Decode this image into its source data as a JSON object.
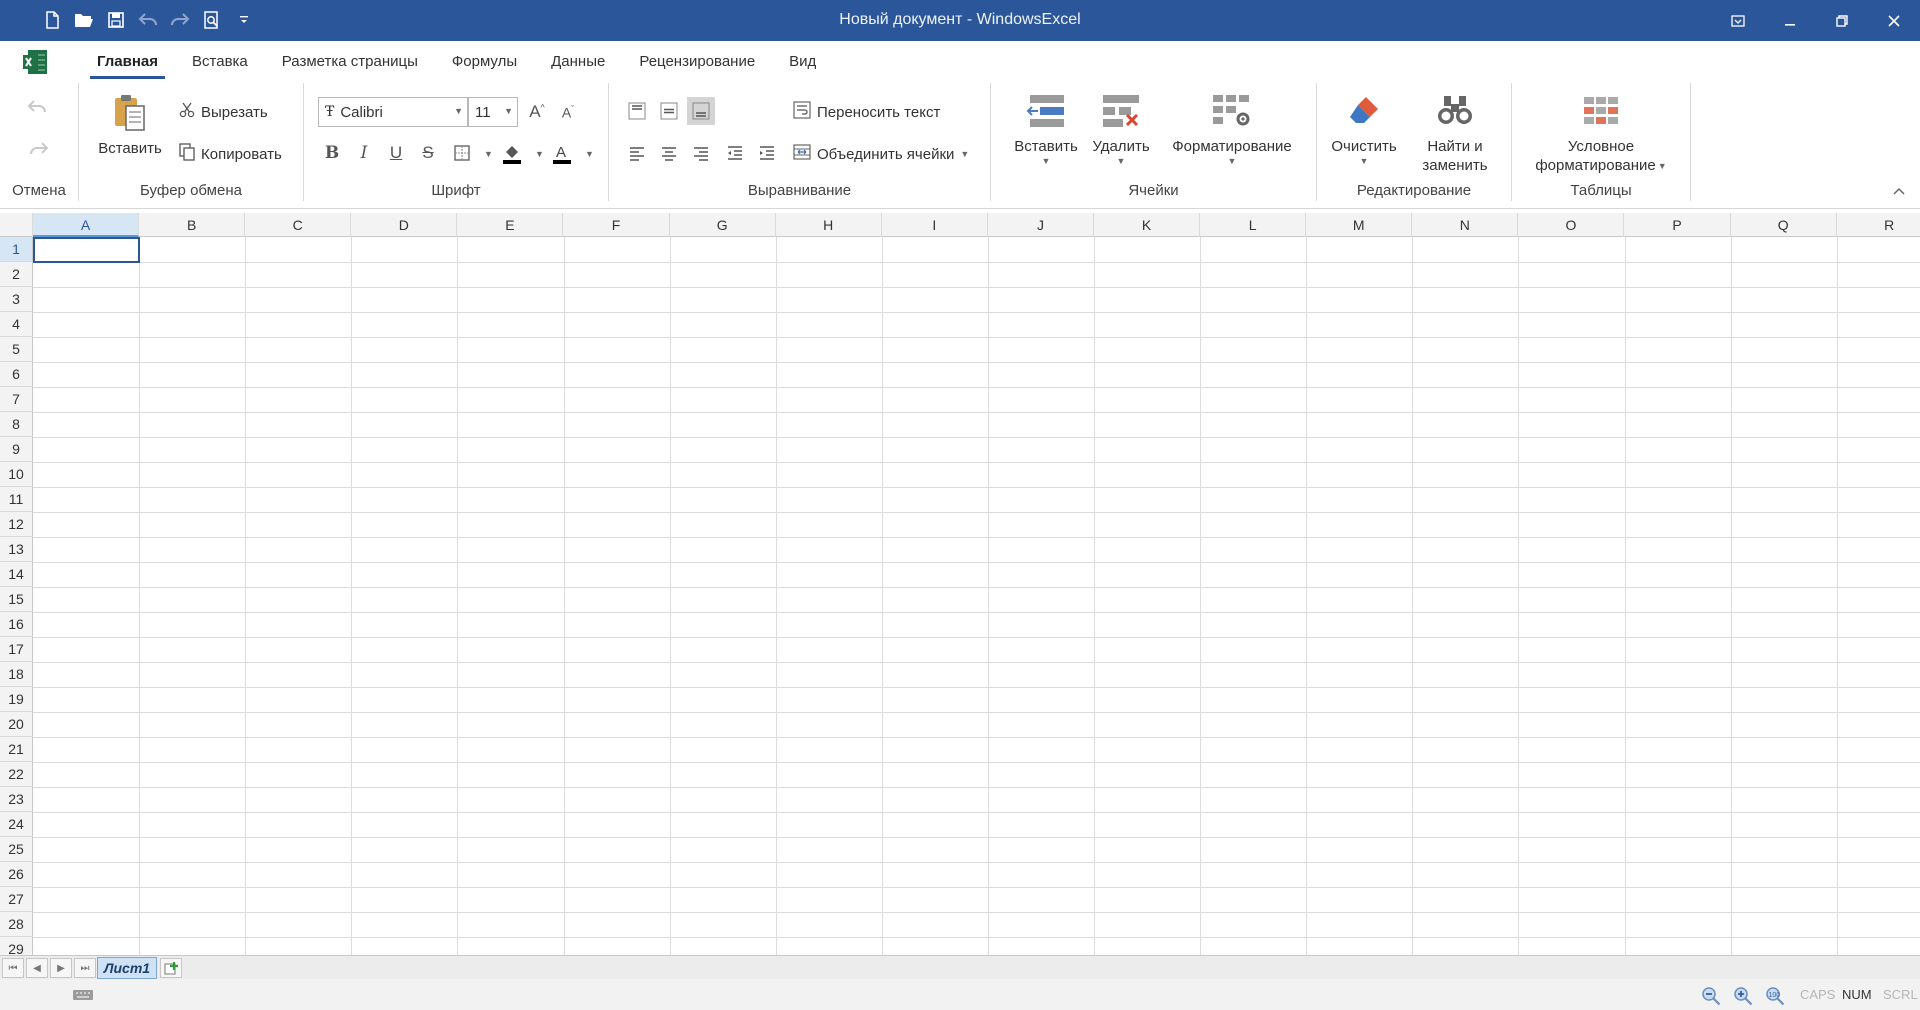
{
  "window": {
    "title": "Новый документ - WindowsExcel"
  },
  "ribbon_tabs": [
    "Главная",
    "Вставка",
    "Разметка страницы",
    "Формулы",
    "Данные",
    "Рецензирование",
    "Вид"
  ],
  "active_tab": "Главная",
  "groups": {
    "undo": {
      "label": "Отмена"
    },
    "clipboard": {
      "label": "Буфер обмена",
      "paste": "Вставить",
      "cut": "Вырезать",
      "copy": "Копировать"
    },
    "font": {
      "label": "Шрифт",
      "font_name": "Calibri",
      "font_size": "11"
    },
    "alignment": {
      "label": "Выравнивание",
      "wrap_text": "Переносить текст",
      "merge_cells": "Объединить ячейки"
    },
    "cells": {
      "label": "Ячейки",
      "insert": "Вставить",
      "delete": "Удалить",
      "format": "Форматирование"
    },
    "editing": {
      "label": "Редактирование",
      "clear": "Очистить",
      "find_line1": "Найти и",
      "find_line2": "заменить"
    },
    "tables": {
      "label": "Таблицы",
      "cond_line1": "Условное",
      "cond_line2": "форматирование"
    }
  },
  "grid": {
    "columns": [
      "A",
      "B",
      "C",
      "D",
      "E",
      "F",
      "G",
      "H",
      "I",
      "J",
      "K",
      "L",
      "M",
      "N",
      "O",
      "P",
      "Q",
      "R"
    ],
    "rows": [
      "1",
      "2",
      "3",
      "4",
      "5",
      "6",
      "7",
      "8",
      "9",
      "10",
      "11",
      "12",
      "13",
      "14",
      "15",
      "16",
      "17",
      "18",
      "19",
      "20",
      "21",
      "22",
      "23",
      "24",
      "25",
      "26",
      "27",
      "28",
      "29"
    ],
    "selected_cell": "A1"
  },
  "sheets": [
    "Лист1"
  ],
  "status": {
    "caps": "CAPS",
    "num": "NUM",
    "scrl": "SCRL"
  },
  "colors": {
    "titlebar": "#2b579a",
    "accent": "#2b579a",
    "excel_green": "#1e7145"
  }
}
